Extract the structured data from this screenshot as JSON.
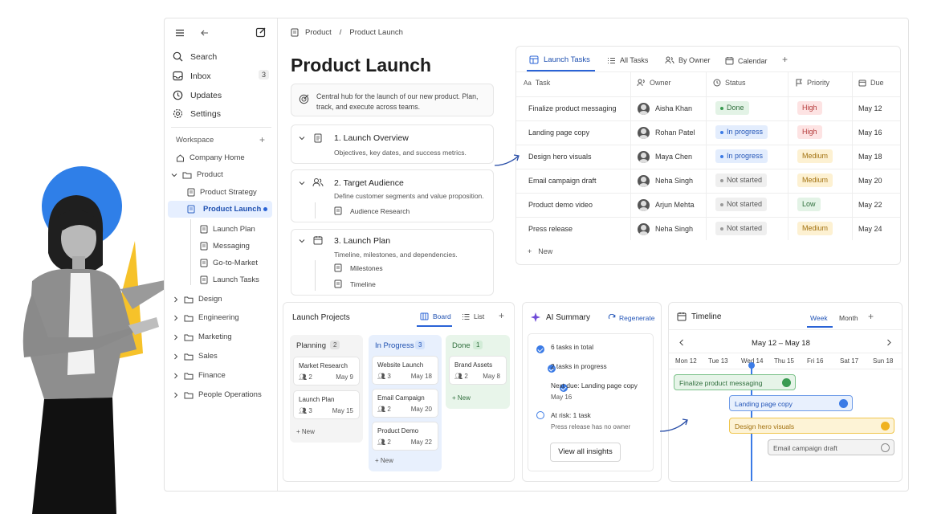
{
  "sidebar": {
    "nav": {
      "search": "Search",
      "inbox": "Inbox",
      "inbox_count": "3",
      "updates": "Updates",
      "settings": "Settings"
    },
    "workspace_label": "Workspace",
    "company_home": "Company Home",
    "product": "Product",
    "product_strategy": "Product Strategy",
    "product_launch": "Product Launch",
    "launch_plan": "Launch Plan",
    "messaging": "Messaging",
    "go_to_market": "Go-to-Market",
    "launch_tasks": "Launch Tasks",
    "folders": [
      "Design",
      "Engineering",
      "Marketing",
      "Sales",
      "Finance",
      "People Operations"
    ]
  },
  "breadcrumb": {
    "root": "Product",
    "sep": "/",
    "current": "Product Launch"
  },
  "page": {
    "title": "Product Launch",
    "description": "Central hub for the launch of our new product. Plan, track, and execute across teams.",
    "sections": [
      {
        "title": "1. Launch Overview",
        "desc": "Objectives, key dates, and success metrics."
      },
      {
        "title": "2. Target Audience",
        "desc": "Define customer segments and value proposition.",
        "children": [
          "Audience Research"
        ]
      },
      {
        "title": "3. Launch Plan",
        "desc": "Timeline, milestones, and dependencies.",
        "children": [
          "Milestones",
          "Timeline"
        ]
      }
    ]
  },
  "tasks_db": {
    "tabs": [
      "Launch Tasks",
      "All Tasks",
      "By Owner",
      "Calendar"
    ],
    "add_tab": "+",
    "columns": {
      "task": "Task",
      "owner": "Owner",
      "status": "Status",
      "priority": "Priority",
      "due": "Due"
    },
    "rows": [
      {
        "task": "Finalize product messaging",
        "owner": "Aisha Khan",
        "status": "Done",
        "priority": "High",
        "due": "May 12"
      },
      {
        "task": "Landing page copy",
        "owner": "Rohan Patel",
        "status": "In progress",
        "priority": "High",
        "due": "May 16"
      },
      {
        "task": "Design hero visuals",
        "owner": "Maya Chen",
        "status": "In progress",
        "priority": "Medium",
        "due": "May 18"
      },
      {
        "task": "Email campaign draft",
        "owner": "Neha Singh",
        "status": "Not started",
        "priority": "Medium",
        "due": "May 20"
      },
      {
        "task": "Product demo video",
        "owner": "Arjun Mehta",
        "status": "Not started",
        "priority": "Low",
        "due": "May 22"
      },
      {
        "task": "Press release",
        "owner": "Neha Singh",
        "status": "Not started",
        "priority": "Medium",
        "due": "May 24"
      }
    ],
    "new_label": "New"
  },
  "projects": {
    "title": "Launch Projects",
    "view_board": "Board",
    "view_list": "List",
    "add": "+",
    "columns": [
      {
        "name": "Planning",
        "count": "2",
        "cards": [
          {
            "title": "Market Research",
            "members": "2",
            "date": "May 9"
          },
          {
            "title": "Launch Plan",
            "members": "3",
            "date": "May 15"
          }
        ]
      },
      {
        "name": "In Progress",
        "count": "3",
        "cards": [
          {
            "title": "Website Launch",
            "members": "3",
            "date": "May 18"
          },
          {
            "title": "Email Campaign",
            "members": "2",
            "date": "May 20"
          },
          {
            "title": "Product Demo",
            "members": "2",
            "date": "May 22"
          }
        ]
      },
      {
        "name": "Done",
        "count": "1",
        "cards": [
          {
            "title": "Brand Assets",
            "members": "2",
            "date": "May 8"
          }
        ]
      }
    ],
    "new_label": "New"
  },
  "ai": {
    "title": "AI Summary",
    "regenerate": "Regenerate",
    "items": [
      {
        "text": "6 tasks in total"
      },
      {
        "text": "2 tasks in progress"
      },
      {
        "text": "Next due: Landing page copy",
        "sub": "May 16"
      },
      {
        "text": "At risk: 1 task",
        "sub": "Press release has no owner"
      }
    ],
    "button": "View all insights"
  },
  "timeline": {
    "title": "Timeline",
    "views": [
      "Week",
      "Month"
    ],
    "add": "+",
    "range": "May 12 – May 18",
    "days": [
      "Mon 12",
      "Tue 13",
      "Wed 14",
      "Thu 15",
      "Fri 16",
      "Sat 17",
      "Sun 18"
    ],
    "bars": [
      {
        "label": "Finalize product messaging"
      },
      {
        "label": "Landing page copy"
      },
      {
        "label": "Design hero visuals"
      },
      {
        "label": "Email campaign draft"
      }
    ]
  },
  "colors": {
    "accent": "#3b7be6",
    "blue_blob": "#2f7fe8",
    "yellow_shape": "#f6c22a"
  }
}
